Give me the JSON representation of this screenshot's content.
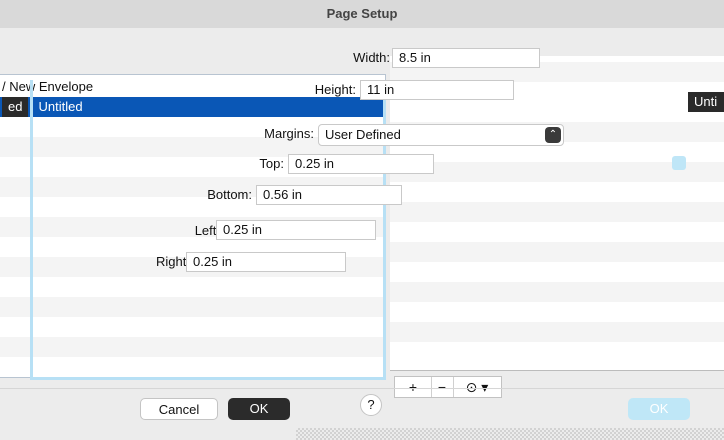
{
  "window": {
    "title": "Page Setup"
  },
  "paper_list": {
    "items": [
      {
        "label": "/ New Envelope",
        "selected": false
      },
      {
        "label": "Untitled",
        "left_cap": "ed",
        "selected": true
      }
    ]
  },
  "right_list": {
    "selected_tag": "Unti"
  },
  "fields": {
    "width": {
      "label": "Width:",
      "value": "8.5 in"
    },
    "height": {
      "label": "Height:",
      "value": "11 in"
    },
    "margins": {
      "label": "Margins:",
      "value": "User Defined"
    },
    "top": {
      "label": "Top:",
      "value": "0.25 in"
    },
    "bottom": {
      "label": "Bottom:",
      "value": "0.56 in"
    },
    "left": {
      "label": "Left:",
      "value": "0.25 in"
    },
    "right": {
      "label": "Right:",
      "value": "0.25 in"
    }
  },
  "tools": {
    "add": "+",
    "remove": "−",
    "more": "⊙ ▾"
  },
  "buttons": {
    "cancel": "Cancel",
    "ok": "OK",
    "help": "?",
    "ok_secondary": "OK"
  },
  "colors": {
    "selection": "#0a57b6",
    "focus": "#b7e0f5",
    "accent_light": "#bfe7f7"
  }
}
